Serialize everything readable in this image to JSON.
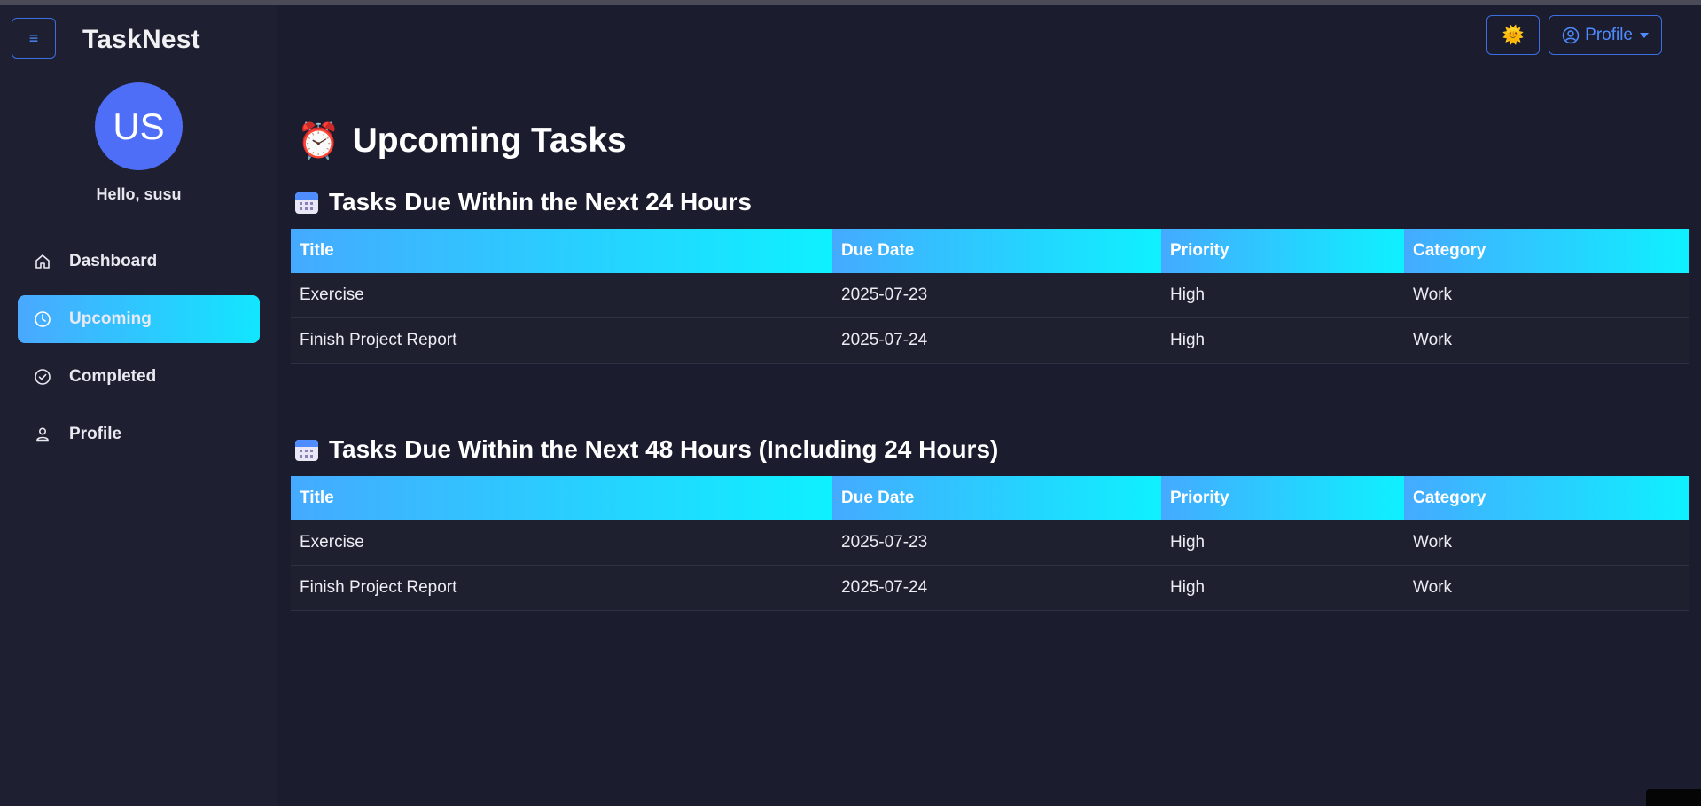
{
  "app": {
    "brand": "TaskNest"
  },
  "sidebar": {
    "avatar_initials": "US",
    "greeting": "Hello, susu",
    "items": [
      {
        "label": "Dashboard",
        "icon": "home-icon",
        "active": false
      },
      {
        "label": "Upcoming",
        "icon": "clock-icon",
        "active": true
      },
      {
        "label": "Completed",
        "icon": "check-circle-icon",
        "active": false
      },
      {
        "label": "Profile",
        "icon": "person-icon",
        "active": false
      }
    ]
  },
  "header": {
    "theme_icon": "sun-emoji-icon",
    "profile_label": "Profile"
  },
  "main": {
    "title": "Upcoming Tasks",
    "title_icon": "alarm-clock-icon",
    "columns": [
      "Title",
      "Due Date",
      "Priority",
      "Category"
    ],
    "sections": [
      {
        "heading": "Tasks Due Within the Next 24 Hours",
        "rows": [
          [
            "Exercise",
            "2025-07-23",
            "High",
            "Work"
          ],
          [
            "Finish Project Report",
            "2025-07-24",
            "High",
            "Work"
          ]
        ]
      },
      {
        "heading": "Tasks Due Within the Next 48 Hours (Including 24 Hours)",
        "rows": [
          [
            "Exercise",
            "2025-07-23",
            "High",
            "Work"
          ],
          [
            "Finish Project Report",
            "2025-07-24",
            "High",
            "Work"
          ]
        ]
      }
    ]
  },
  "colors": {
    "background": "#1b1c2e",
    "sidebar": "#1e1f30",
    "accent_start": "#45aaff",
    "accent_end": "#0ef1ff",
    "primary": "#4f6ef7"
  }
}
